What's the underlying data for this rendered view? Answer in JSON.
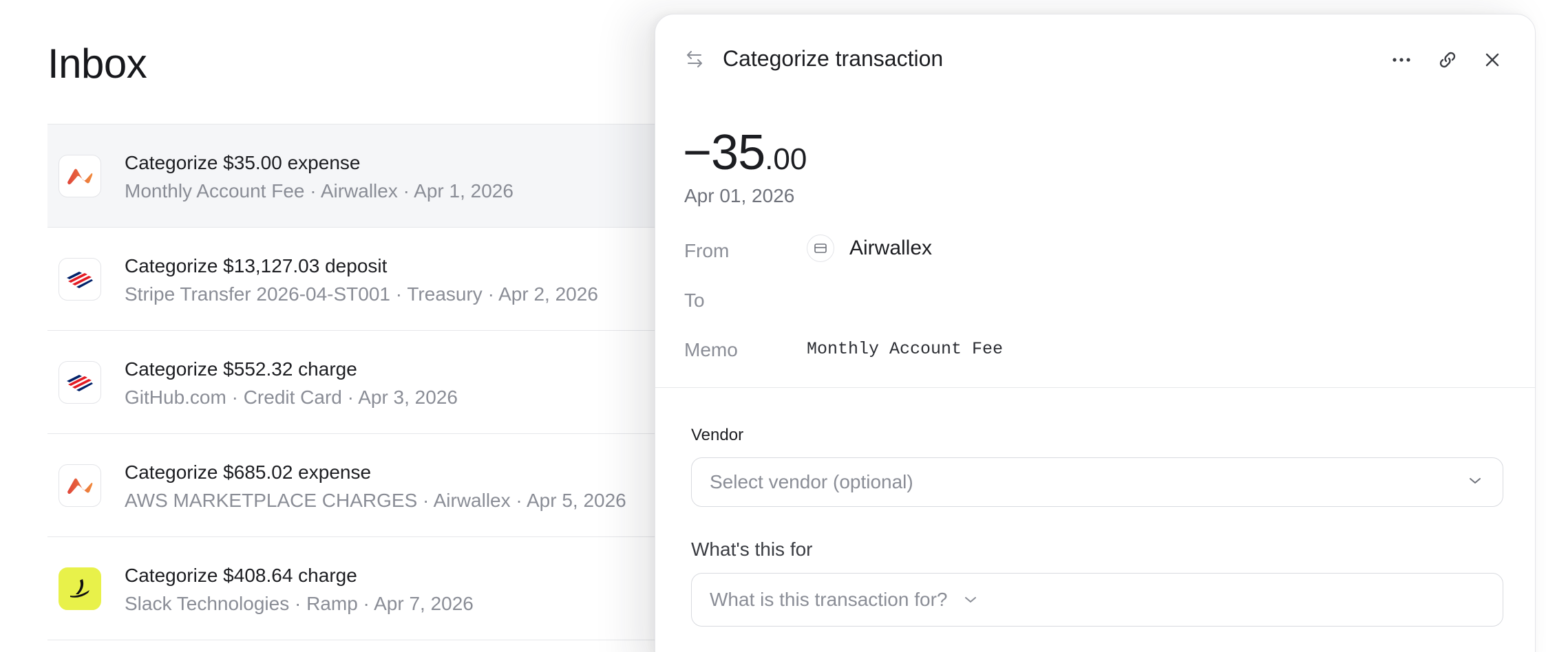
{
  "inbox": {
    "title": "Inbox",
    "items": [
      {
        "title": "Categorize $35.00 expense",
        "subtitle": "Monthly Account Fee · Airwallex · Apr 1, 2026",
        "logo": "airwallex-logo",
        "selected": true
      },
      {
        "title": "Categorize $13,127.03 deposit",
        "subtitle": "Stripe Transfer 2026-04-ST001 · Treasury · Apr 2, 2026",
        "logo": "bank-of-america-logo",
        "selected": false
      },
      {
        "title": "Categorize $552.32 charge",
        "subtitle": "GitHub.com · Credit Card · Apr 3, 2026",
        "logo": "bank-of-america-logo",
        "selected": false
      },
      {
        "title": "Categorize $685.02 expense",
        "subtitle": "AWS MARKETPLACE CHARGES · Airwallex · Apr 5, 2026",
        "logo": "airwallex-logo",
        "selected": false
      },
      {
        "title": "Categorize $408.64 charge",
        "subtitle": "Slack Technologies · Ramp · Apr 7, 2026",
        "logo": "ramp-logo",
        "selected": false
      }
    ]
  },
  "panel": {
    "title": "Categorize transaction",
    "amount_whole": "−35",
    "amount_cents": ".00",
    "date": "Apr 01, 2026",
    "from_label": "From",
    "from_value": "Airwallex",
    "to_label": "To",
    "memo_label": "Memo",
    "memo_value": "Monthly Account Fee",
    "vendor_label": "Vendor",
    "vendor_placeholder": "Select vendor (optional)",
    "purpose_label": "What's this for",
    "purpose_placeholder": "What is this transaction for?"
  },
  "icons": {
    "header_left": "transfer-arrows-icon",
    "more": "more-horizontal-icon",
    "link": "link-icon",
    "close": "close-icon",
    "account": "bank-card-icon",
    "chevron": "chevron-down-icon"
  },
  "colors": {
    "airwallex_orange": "#e8643a",
    "boa_red": "#e31b23",
    "boa_navy": "#012169",
    "ramp_yellow": "#e8f14a",
    "selected_row": "#f5f6f8"
  }
}
